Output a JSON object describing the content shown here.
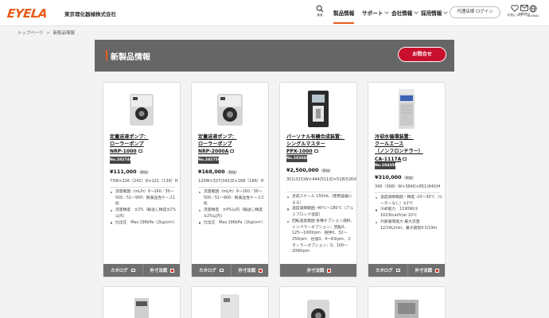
{
  "header": {
    "logo": "EYELA",
    "company": "東京理化器械株式会社",
    "search_label": "検索",
    "nav": [
      {
        "label": "製品情報",
        "active": true
      },
      {
        "label": "サポート",
        "active": false
      },
      {
        "label": "会社情報",
        "active": false
      },
      {
        "label": "採用情報",
        "active": false
      }
    ],
    "login": "代理店様 ログイン",
    "favorites": "お気に入り",
    "contact": "お問合せ",
    "global": "GLOBAL"
  },
  "breadcrumb": {
    "home": "トップページ",
    "sep": ">",
    "current": "新製品情報"
  },
  "page": {
    "title": "新製品情報",
    "contact_button": "お問合せ"
  },
  "products": [
    {
      "name_lines": [
        "定量送液ポンプ：",
        "ローラーポンプ",
        "NRP-1000"
      ],
      "code": "No.282740",
      "price": "¥111,000",
      "tax_note": "（税抜）",
      "dims": "73W×226（241）D×121（139）H",
      "specs": [
        "流量範囲（mL/h）9～160／30～500／51～900：耐薬品性ケース1段",
        "流量精度　±2%（輸送し精度±1%以内）",
        "吐出圧　Max.196kPa（2kg/cm²）"
      ],
      "catalog": "カタログ",
      "drawing": "外寸法図"
    },
    {
      "name_lines": [
        "定量送液ポンプ：",
        "ローラーポンプ",
        "NRP-2000A"
      ],
      "code": "No.282750",
      "price": "¥168,000",
      "tax_note": "（税抜）",
      "dims": "120W×327(342)D×168（186）H",
      "specs": [
        "流量範囲（mL/h）9～160／30～500／51～900：耐薬品性ケース3段",
        "流量精度　±4%以内（輸送し精度±2%以内）",
        "吐出圧　Max.196kPa（2kg/cm²）"
      ],
      "catalog": "カタログ",
      "drawing": "外寸法図"
    },
    {
      "name_lines": [
        "パーソナル有機合成装置：",
        "シングルマスター",
        "PPX-1000"
      ],
      "code": "No.283040",
      "price": "¥2,500,000",
      "tax_note": "（税抜）",
      "dims": "301(315)W×444(511)D×518(526)H",
      "specs": [
        "合成スケール 150mL（使用容器による）",
        "温度調節範囲 -40℃～180℃（アルミブロック温度）",
        "回転速度範囲 各種オプション選択、インペラーオプション：回転0、125～1000rpm　撹拌0、32～250rpm　往復0、4～63rpm、スターラーオプション：0、100～2000rpm"
      ],
      "drawing": "外寸法図"
    },
    {
      "name_lines": [
        "冷却水循環装置：",
        "クールエース",
        "（ノンフロンチラー）",
        "CA-1117A"
      ],
      "code": "No.284350",
      "price": "¥310,000",
      "tax_note": "（税抜）",
      "dims": "340（368）W×384D×851(940)H",
      "specs": [
        "温度調節範囲・精度 -20～30℃（ヒーターなし）±2℃",
        "冷却能力　1190W(冷1023kcal/h)at 10℃",
        "外部循環能力 最大流量12/14L/min、最大揚程9.5/19m"
      ],
      "catalog": "カタログ",
      "drawing": "外寸法図"
    }
  ],
  "colors": {
    "accent": "#e85a16",
    "band": "#666666",
    "contact": "#c8102e",
    "card_footer": "#707070"
  }
}
